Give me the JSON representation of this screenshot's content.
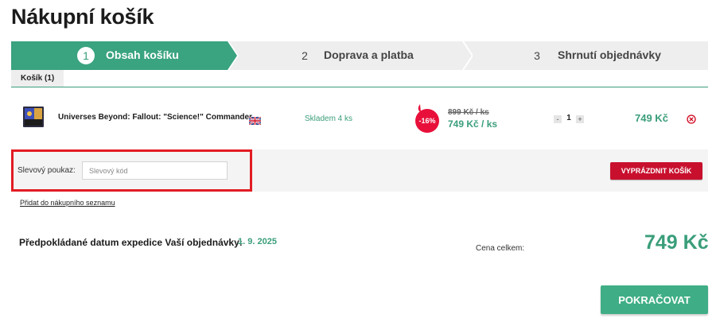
{
  "page": {
    "title": "Nákupní košík"
  },
  "steps": [
    {
      "number": "1",
      "label": "Obsah košíku",
      "active": true
    },
    {
      "number": "2",
      "label": "Doprava a platba",
      "active": false
    },
    {
      "number": "3",
      "label": "Shrnutí objednávky",
      "active": false
    }
  ],
  "tabs": {
    "cart_label": "Košík (1)"
  },
  "cart_item": {
    "name": "Universes Beyond: Fallout: \"Science!\" Commander...",
    "language_flag": "uk-flag-icon",
    "stock": "Skladem 4 ks",
    "discount": "-16%",
    "old_price": "899 Kč / ks",
    "new_price": "749 Kč / ks",
    "quantity_minus": "-",
    "quantity": "1",
    "quantity_plus": "+",
    "line_total": "749 Kč",
    "remove_icon": "close-circle-icon"
  },
  "voucher": {
    "label": "Slevový poukaz:",
    "placeholder": "Slevový kód",
    "empty_cart_button": "VYPRÁZDNIT KOŠÍK"
  },
  "shopping_list_link": "Přidat do nákupního seznamu",
  "expedition": {
    "label": "Předpokládané datum expedice Vaší objednávky:",
    "date": "1. 9. 2025"
  },
  "total": {
    "label": "Cena celkem:",
    "value": "749 Kč"
  },
  "continue_button": "POKRAČOVAT",
  "colors": {
    "accent": "#3a9e7a",
    "danger": "#c8102e",
    "highlight_border": "#e21c23",
    "step_inactive": "#eeeeee"
  }
}
